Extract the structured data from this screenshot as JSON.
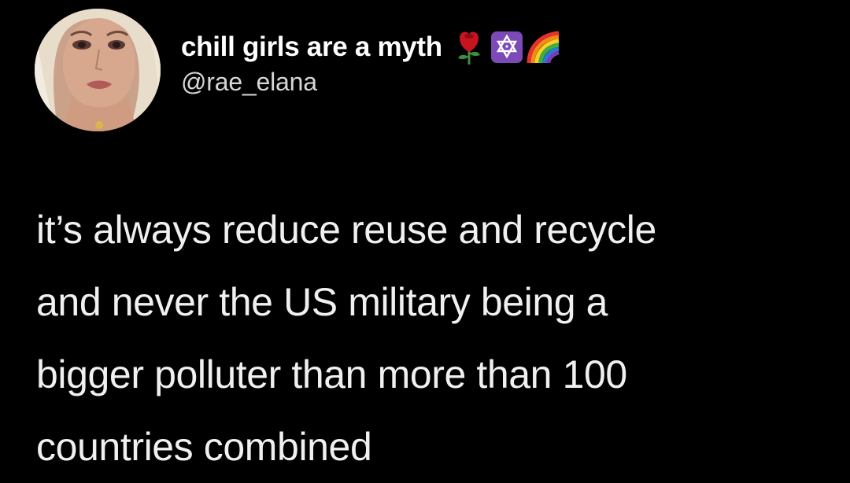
{
  "user": {
    "display_name": "chill girls are a myth",
    "handle": "@rae_elana",
    "name_emojis": [
      "rose-emoji",
      "star-of-david-emoji",
      "rainbow-emoji"
    ]
  },
  "tweet": {
    "lines": [
      "it’s always reduce reuse and recycle",
      "and never the US military being a",
      "bigger polluter than more than 100",
      "countries combined"
    ]
  },
  "colors": {
    "background": "#000000",
    "text": "#f0f0f0",
    "handle": "#d7d7d7",
    "emoji_purple": "#7b4ab8"
  }
}
